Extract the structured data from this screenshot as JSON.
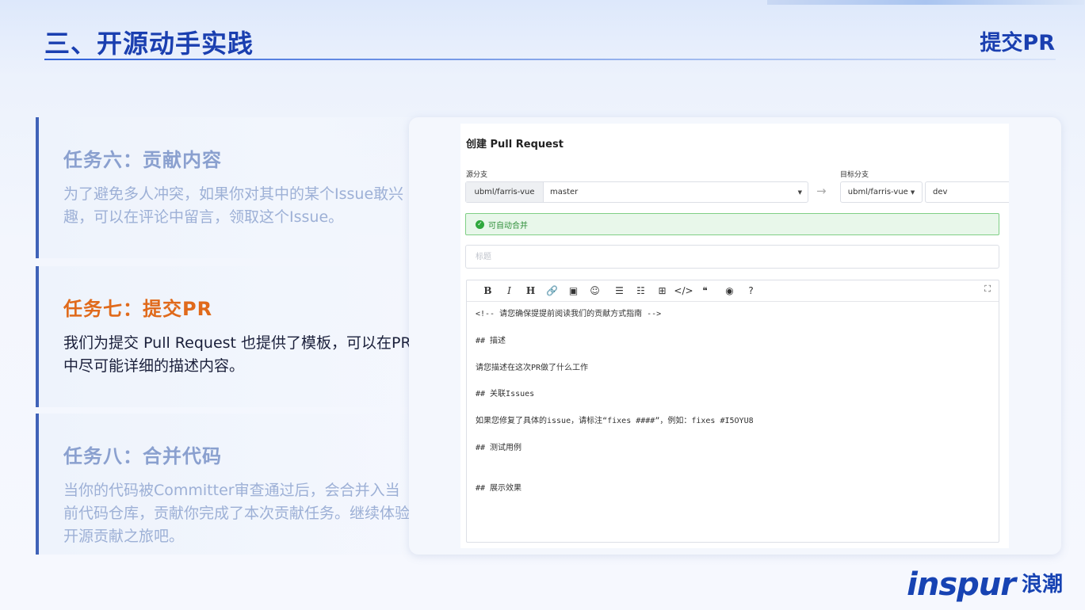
{
  "slide": {
    "title": "三、开源动手实践",
    "subtitle": "提交PR",
    "logo_en": "inspur",
    "logo_cn": "浪潮"
  },
  "tasks": [
    {
      "title": "任务六：贡献内容",
      "desc": "为了避免多人冲突，如果你对其中的某个Issue敢兴趣，可以在评论中留言，领取这个Issue。"
    },
    {
      "title": "任务七：提交PR",
      "desc": "我们为提交 Pull Request 也提供了模板，可以在PR中尽可能详细的描述内容。"
    },
    {
      "title": "任务八：合并代码",
      "desc": "当你的代码被Committer审查通过后，会合并入当前代码仓库，贡献你完成了本次贡献任务。继续体验开源贡献之旅吧。"
    }
  ],
  "pr_form": {
    "heading": "创建 Pull Request",
    "source_label": "源分支",
    "target_label": "目标分支",
    "source_repo": "ubml/farris-vue",
    "source_branch": "master",
    "target_repo": "ubml/farris-vue",
    "target_branch": "dev",
    "merge_status": "可自动合并",
    "title_placeholder": "标题",
    "toolbar": {
      "bold": "B",
      "italic": "I",
      "heading": "H",
      "link": "🔗",
      "image": "▣",
      "emoji": "☺",
      "ul": "☰",
      "ol": "☷",
      "table": "⊞",
      "code": "</>",
      "quote": "❝",
      "preview": "◉",
      "help": "?",
      "fullscreen": "⛶"
    },
    "body_lines": [
      "<!-- 请您确保提提前阅读我们的贡献方式指南 -->",
      "",
      "## 描述",
      "",
      "请您描述在这次PR做了什么工作",
      "",
      "## 关联Issues",
      "",
      "如果您修复了具体的issue，请标注“fixes ####”，例如：fixes #I5OYU8",
      "",
      "## 测试用例",
      "",
      "",
      "## 展示效果"
    ]
  }
}
